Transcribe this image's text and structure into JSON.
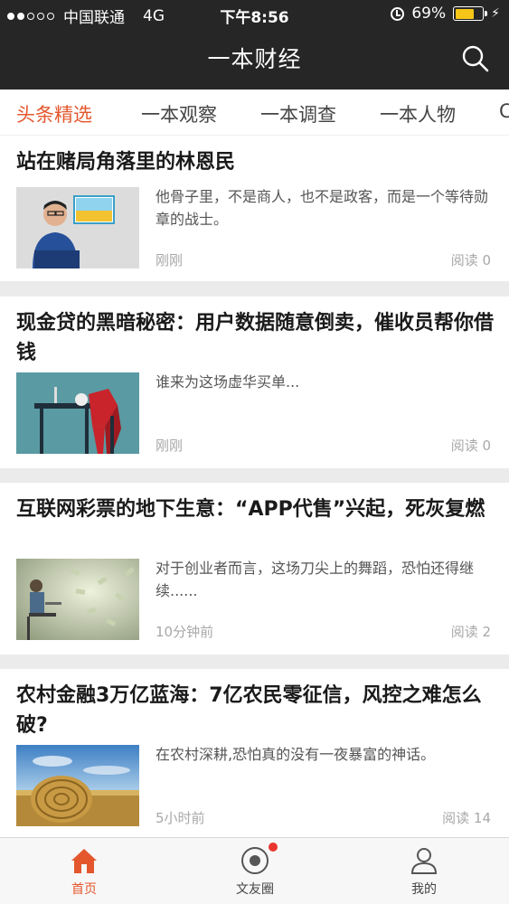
{
  "status_bar": {
    "carrier": "中国联通",
    "network": "4G",
    "time": "下午8:56",
    "battery": "69%",
    "battery_level": 0.69
  },
  "header": {
    "title": "一本财经"
  },
  "tabs": [
    {
      "label": "头条精选",
      "active": true
    },
    {
      "label": "一本观察",
      "active": false
    },
    {
      "label": "一本调查",
      "active": false
    },
    {
      "label": "一本人物",
      "active": false
    },
    {
      "label": "C",
      "active": false
    }
  ],
  "articles": [
    {
      "title": "站在赌局角落里的林恩民",
      "summary": "他骨子里，不是商人，也不是政客，而是一个等待勋章的战士。",
      "time": "刚刚",
      "reads": "阅读 0"
    },
    {
      "title": "现金贷的黑暗秘密：用户数据随意倒卖，催收员帮你借钱",
      "summary": "谁来为这场虚华买单...",
      "time": "刚刚",
      "reads": "阅读 0"
    },
    {
      "title": "互联网彩票的地下生意：“APP代售”兴起，死灰复燃",
      "summary": "对于创业者而言，这场刀尖上的舞蹈，恐怕还得继续......",
      "time": "10分钟前",
      "reads": "阅读 2"
    },
    {
      "title": "农村金融3万亿蓝海：7亿农民零征信，风控之难怎么破?",
      "summary": "在农村深耕,恐怕真的没有一夜暴富的神话。",
      "time": "5小时前",
      "reads": "阅读 14"
    }
  ],
  "tab_bar": {
    "items": [
      {
        "label": "首页",
        "icon": "home-icon",
        "active": true
      },
      {
        "label": "文友圈",
        "icon": "record-icon",
        "active": false
      },
      {
        "label": "我的",
        "icon": "profile-icon",
        "active": false
      }
    ]
  },
  "colors": {
    "accent": "#e4572e",
    "nav_background": "#262626",
    "badge": "#e8362f"
  }
}
